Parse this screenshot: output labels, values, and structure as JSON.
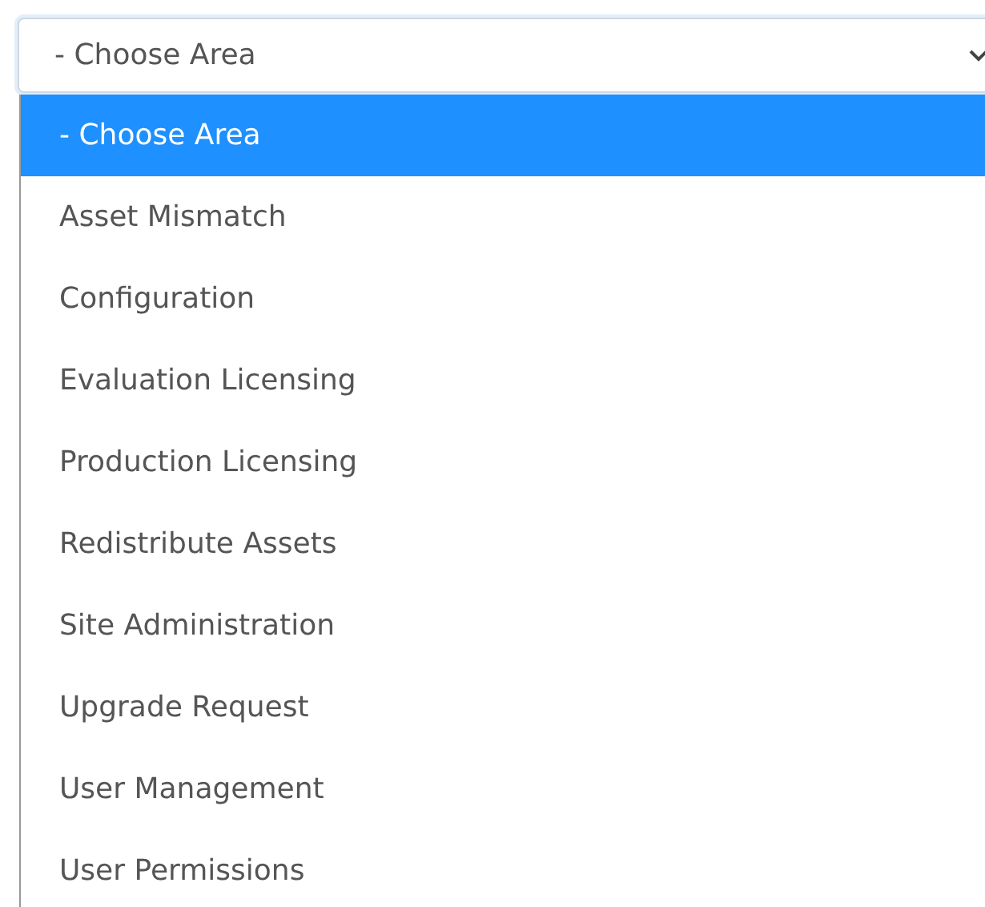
{
  "select": {
    "value": "- Choose Area"
  },
  "options": [
    {
      "label": "- Choose Area",
      "selected": true
    },
    {
      "label": "Asset Mismatch",
      "selected": false
    },
    {
      "label": "Configuration",
      "selected": false
    },
    {
      "label": "Evaluation Licensing",
      "selected": false
    },
    {
      "label": "Production Licensing",
      "selected": false
    },
    {
      "label": "Redistribute Assets",
      "selected": false
    },
    {
      "label": "Site Administration",
      "selected": false
    },
    {
      "label": "Upgrade Request",
      "selected": false
    },
    {
      "label": "User Management",
      "selected": false
    },
    {
      "label": "User Permissions",
      "selected": false
    }
  ]
}
